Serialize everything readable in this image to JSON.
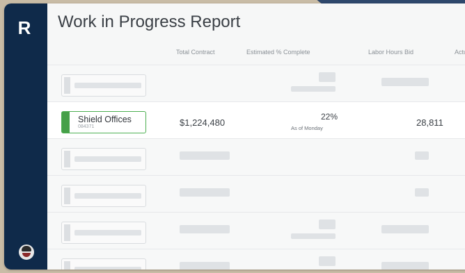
{
  "app": {
    "logo_letter": "R"
  },
  "page": {
    "title": "Work in Progress Report"
  },
  "table": {
    "headers": [
      "Total Contract",
      "Estimated % Complete",
      "Labor Hours Bid",
      "Actu"
    ],
    "active_row": {
      "job_name": "Shield Offices",
      "job_number": "084371",
      "total_contract": "$1,224,480",
      "percent_complete": "22%",
      "percent_note": "As of Monday",
      "labor_hours_bid": "28,811"
    }
  },
  "colors": {
    "sidebar": "#0f2a4a",
    "active_accent": "#4caf50"
  }
}
